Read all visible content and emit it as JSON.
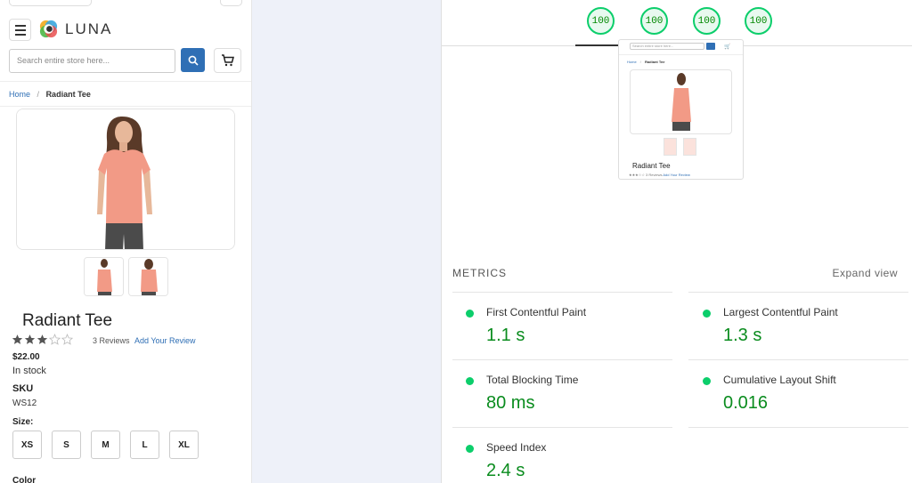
{
  "store": {
    "brand": "LUNA",
    "search_placeholder": "Search entire store here...",
    "breadcrumb": {
      "home": "Home",
      "separator": "/",
      "current": "Radiant Tee"
    },
    "product": {
      "title": "Radiant Tee",
      "rating_stars_filled": 3,
      "rating_stars_total": 5,
      "reviews": "3 Reviews",
      "add_review": "Add Your Review",
      "price": "$22.00",
      "stock": "In stock",
      "sku_label": "SKU",
      "sku": "WS12",
      "size_label": "Size:",
      "sizes": [
        "XS",
        "S",
        "M",
        "L",
        "XL"
      ],
      "color_label": "Color"
    }
  },
  "lighthouse": {
    "scores": [
      "100",
      "100",
      "100",
      "100"
    ],
    "thumbnail": {
      "search_placeholder": "Search entire store here...",
      "breadcrumb_home": "Home",
      "breadcrumb_current": "Radiant Tee",
      "title": "Radiant Tee",
      "reviews": "3 Reviews",
      "add_review": "Add Your Review"
    },
    "metrics_title": "METRICS",
    "expand_view": "Expand view",
    "metrics": [
      {
        "label": "First Contentful Paint",
        "value": "1.1 s",
        "status_color": "#0cce6b"
      },
      {
        "label": "Largest Contentful Paint",
        "value": "1.3 s",
        "status_color": "#0cce6b"
      },
      {
        "label": "Total Blocking Time",
        "value": "80 ms",
        "status_color": "#0cce6b"
      },
      {
        "label": "Cumulative Layout Shift",
        "value": "0.016",
        "status_color": "#0cce6b"
      },
      {
        "label": "Speed Index",
        "value": "2.4 s",
        "status_color": "#0cce6b"
      }
    ]
  },
  "colors": {
    "accent": "#2f6fb5",
    "pass": "#0cce6b",
    "pass_text": "#0a8c1e",
    "gap_bg": "#eef1f9"
  }
}
